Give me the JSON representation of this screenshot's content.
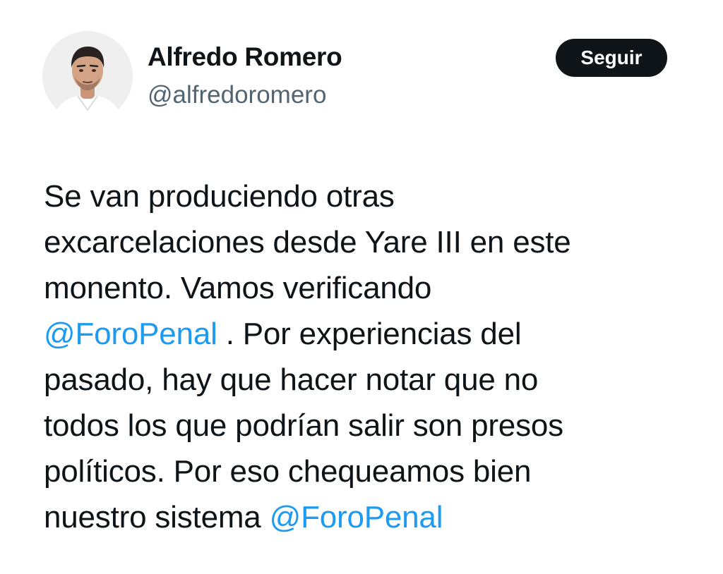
{
  "author": {
    "display_name": "Alfredo Romero",
    "handle": "@alfredoromero",
    "avatar_icon": "profile-photo"
  },
  "follow_button": {
    "label": "Seguir"
  },
  "tweet": {
    "line1": "Se van produciendo otras",
    "line2": "excarcelaciones desde Yare III en este",
    "line3": "monento. Vamos verificando",
    "mention1": "@ForoPenal",
    "line4_rest": " . Por experiencias del",
    "line5": "pasado, hay que hacer notar que no",
    "line6": "todos los que podrían salir son presos",
    "line7": "políticos. Por eso chequeamos bien",
    "line8_start": "nuestro sistema ",
    "mention2": "@ForoPenal"
  },
  "colors": {
    "text": "#0f1419",
    "secondary": "#536471",
    "link": "#1d9bf0",
    "button_bg": "#0f1419",
    "button_text": "#ffffff"
  }
}
